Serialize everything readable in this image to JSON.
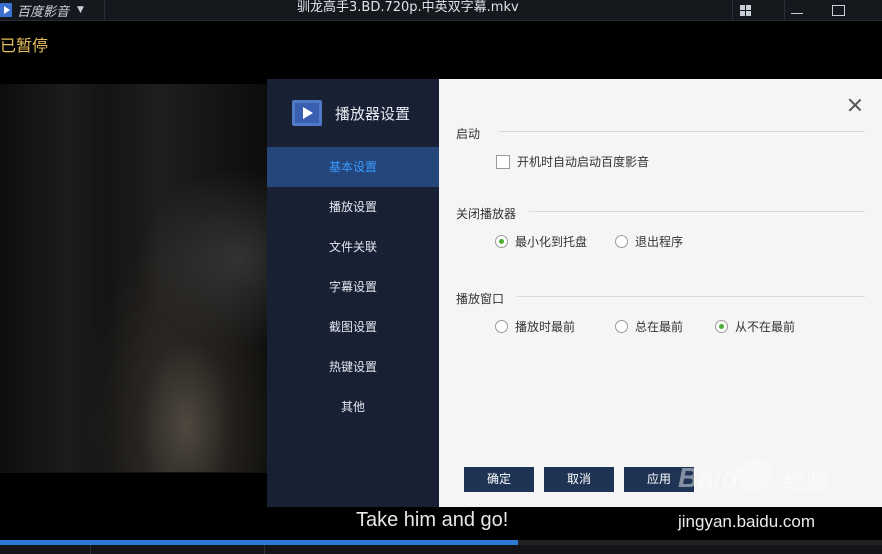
{
  "titlebar": {
    "app_name": "百度影音",
    "file_title": "驯龙高手3.BD.720p.中英双字幕.mkv",
    "icons": [
      "app-logo-icon",
      "chevron-down-icon",
      "grid-icon",
      "minimize-icon",
      "maximize-icon"
    ]
  },
  "status": {
    "paused_text": "已暂停"
  },
  "dialog": {
    "title": "播放器设置",
    "nav": [
      {
        "label": "基本设置",
        "active": true
      },
      {
        "label": "播放设置",
        "active": false
      },
      {
        "label": "文件关联",
        "active": false
      },
      {
        "label": "字幕设置",
        "active": false
      },
      {
        "label": "截图设置",
        "active": false
      },
      {
        "label": "热键设置",
        "active": false
      },
      {
        "label": "其他",
        "active": false
      }
    ],
    "sections": {
      "startup": {
        "title": "启动",
        "autostart_label": "开机时自动启动百度影音",
        "autostart_checked": false
      },
      "close": {
        "title": "关闭播放器",
        "options": [
          "最小化到托盘",
          "退出程序"
        ],
        "selected": "最小化到托盘"
      },
      "window": {
        "title": "播放窗口",
        "options": [
          "播放时最前",
          "总在最前",
          "从不在最前"
        ],
        "selected": "从不在最前"
      }
    },
    "buttons": {
      "ok": "确定",
      "cancel": "取消",
      "apply": "应用"
    }
  },
  "subtitle": "Take him and go!",
  "progress": {
    "fraction": 0.587
  },
  "watermark": {
    "brand": "Baid",
    "cn": "经验",
    "url": "jingyan.baidu.com"
  },
  "colors": {
    "accent": "#3a9bff",
    "nav_active_bg": "#24467a",
    "radio_on": "#4cae32",
    "paused": "#e5c05a",
    "progress": "#2b7bd6"
  }
}
